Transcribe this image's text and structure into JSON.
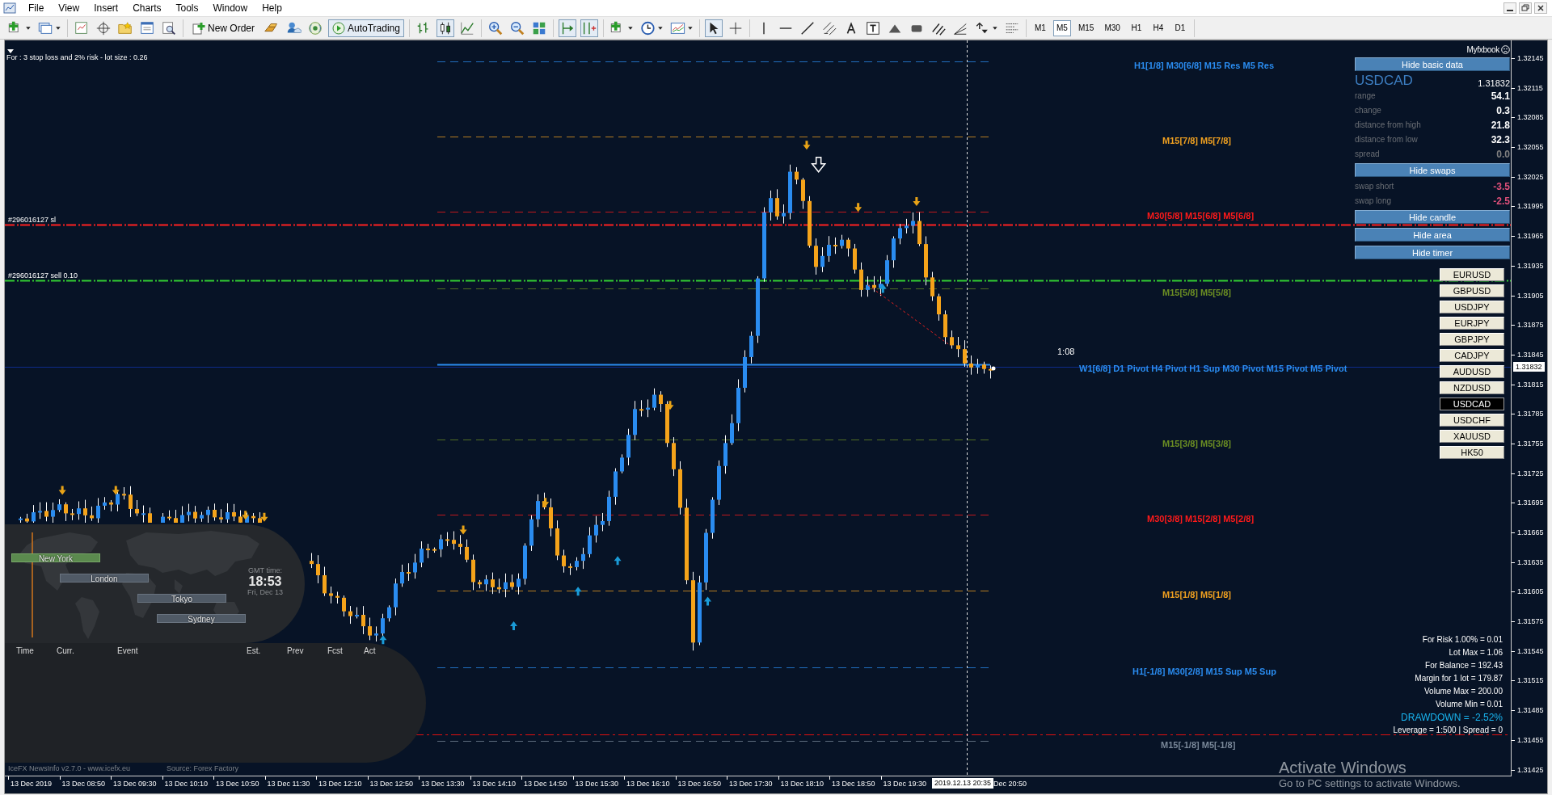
{
  "menu": [
    "File",
    "View",
    "Insert",
    "Charts",
    "Tools",
    "Window",
    "Help"
  ],
  "toolbar": [
    [
      {
        "kind": "icon",
        "pressed": false
      },
      {
        "kind": "icon",
        "pressed": false
      }
    ],
    [
      {
        "kind": "icon",
        "pressed": false
      },
      {
        "kind": "icon",
        "pressed": false
      },
      {
        "kind": "icon",
        "pressed": false
      },
      {
        "kind": "icon",
        "pressed": false
      },
      {
        "kind": "icon",
        "pressed": false
      }
    ],
    [
      {
        "kind": "text",
        "label": "New Order",
        "pressed": false
      },
      {
        "kind": "icon",
        "pressed": false
      },
      {
        "kind": "icon",
        "pressed": false
      },
      {
        "kind": "icon",
        "pressed": false
      },
      {
        "kind": "text",
        "label": "AutoTrading",
        "pressed": true
      }
    ],
    [
      {
        "kind": "icon",
        "pressed": false
      },
      {
        "kind": "icon",
        "pressed": true
      },
      {
        "kind": "icon",
        "pressed": false
      }
    ],
    [
      {
        "kind": "icon",
        "pressed": false
      },
      {
        "kind": "icon",
        "pressed": false
      },
      {
        "kind": "icon",
        "pressed": false
      }
    ],
    [
      {
        "kind": "icon",
        "pressed": true
      },
      {
        "kind": "icon",
        "pressed": true
      }
    ],
    [
      {
        "kind": "icon",
        "pressed": false
      },
      {
        "kind": "icon",
        "pressed": false
      },
      {
        "kind": "icon",
        "pressed": false
      }
    ],
    [
      {
        "kind": "icon",
        "pressed": true
      },
      {
        "kind": "icon",
        "pressed": false
      }
    ],
    [
      {
        "kind": "icon",
        "pressed": false
      },
      {
        "kind": "icon",
        "pressed": false
      },
      {
        "kind": "icon",
        "pressed": false
      },
      {
        "kind": "icon",
        "pressed": false
      },
      {
        "kind": "icon",
        "pressed": false
      },
      {
        "kind": "icon",
        "pressed": false
      },
      {
        "kind": "icon",
        "pressed": false
      },
      {
        "kind": "icon",
        "pressed": false
      },
      {
        "kind": "icon",
        "pressed": false
      },
      {
        "kind": "icon",
        "pressed": false
      },
      {
        "kind": "icon",
        "pressed": false
      },
      {
        "kind": "icon",
        "pressed": false
      }
    ]
  ],
  "periods": [
    {
      "label": "M1",
      "selected": false
    },
    {
      "label": "M5",
      "selected": true
    },
    {
      "label": "M15",
      "selected": false
    },
    {
      "label": "M30",
      "selected": false
    },
    {
      "label": "H1",
      "selected": false
    },
    {
      "label": "H4",
      "selected": false
    },
    {
      "label": "D1",
      "selected": false
    }
  ],
  "chart": {
    "note": "For : 3 stop loss and 2% risk - lot size : 0.26",
    "trade_lines": [
      {
        "label": "#296016127 sl",
        "color": "#ff2020"
      },
      {
        "label": "#296016127 sell 0.10",
        "color": "#32cd32"
      }
    ],
    "levels": [
      {
        "label": "H1[1/8] M30[6/8] M15 Res  M5 Res",
        "color": "#2a8cf0",
        "kind": "dashed"
      },
      {
        "label": "M15[7/8]  M5[7/8]",
        "color": "#f0a020",
        "kind": "dashed"
      },
      {
        "label": "M30[5/8] M15[6/8]  M5[6/8]",
        "color": "#ff1a1a",
        "kind": "dashed"
      },
      {
        "label": "M15[5/8]  M5[5/8]",
        "color": "#6b8e23",
        "kind": "dashed"
      },
      {
        "label": "W1[6/8] D1 Pivot H4 Pivot H1 Sup M30 Pivot M15 Pivot  M5 Pivot",
        "color": "#2a8cf0",
        "kind": "solid"
      },
      {
        "label": "M15[3/8]  M5[3/8]",
        "color": "#6b8e23",
        "kind": "dashed"
      },
      {
        "label": "M30[3/8] M15[2/8]  M5[2/8]",
        "color": "#ff1a1a",
        "kind": "dashed"
      },
      {
        "label": "M15[1/8]  M5[1/8]",
        "color": "#f0a020",
        "kind": "dashed"
      },
      {
        "label": "H1[-1/8] M30[2/8] M15 Sup  M5 Sup",
        "color": "#2a8cf0",
        "kind": "dashed"
      },
      {
        "label": "M15[-1/8]  M5[-1/8]",
        "color": "#7a8899",
        "kind": "dashed"
      }
    ],
    "timer": "1:08",
    "myfxbook": {
      "brand": "Myfxbook",
      "sections": [
        {
          "button": "Hide basic data",
          "symbol": "USDCAD",
          "price": "1.31832",
          "rows": [
            {
              "label": "range",
              "value": "54.1",
              "color": "#ffffff"
            },
            {
              "label": "change",
              "value": "0.3",
              "color": "#ffffff"
            },
            {
              "label": "distance from high",
              "value": "21.8",
              "color": "#ffffff"
            },
            {
              "label": "distance from low",
              "value": "32.3",
              "color": "#ffffff"
            },
            {
              "label": "spread",
              "value": "0.0",
              "color": "#808080"
            }
          ]
        },
        {
          "button": "Hide swaps",
          "rows": [
            {
              "label": "swap short",
              "value": "-3.5",
              "color": "#e0507a"
            },
            {
              "label": "swap long",
              "value": "-2.5",
              "color": "#e0507a"
            }
          ]
        }
      ],
      "buttons": [
        "Hide candle",
        "Hide area",
        "Hide timer"
      ]
    },
    "symbols": [
      {
        "label": "EURUSD",
        "selected": false
      },
      {
        "label": "GBPUSD",
        "selected": false
      },
      {
        "label": "USDJPY",
        "selected": false
      },
      {
        "label": "EURJPY",
        "selected": false
      },
      {
        "label": "GBPJPY",
        "selected": false
      },
      {
        "label": "CADJPY",
        "selected": false
      },
      {
        "label": "AUDUSD",
        "selected": false
      },
      {
        "label": "NZDUSD",
        "selected": false
      },
      {
        "label": "USDCAD",
        "selected": true
      },
      {
        "label": "USDCHF",
        "selected": false
      },
      {
        "label": "XAUUSD",
        "selected": false
      },
      {
        "label": "HK50",
        "selected": false
      }
    ],
    "account_info": [
      "For Risk 1.00% = 0.01",
      "Lot Max = 1.06",
      "For Balance = 192.43",
      "Margin for 1 lot = 179.87",
      "Volume Max = 200.00",
      "Volume Min = 0.01"
    ],
    "drawdown": "DRAWDOWN = -2.52%",
    "leverage": "Leverage = 1:500 | Spread = 0",
    "news": {
      "sessions": [
        {
          "label": "New York",
          "active": true
        },
        {
          "label": "London",
          "active": false
        },
        {
          "label": "Tokyo",
          "active": false
        },
        {
          "label": "Sydney",
          "active": false
        }
      ],
      "gmt_label": "GMT time:",
      "time": "18:53",
      "date": "Fri, Dec 13",
      "columns": [
        "Time",
        "Curr.",
        "Event",
        "Est.",
        "Prev",
        "Fcst",
        "Act"
      ],
      "footer": "IceFX NewsInfo v2.7.0  -  www.icefx.eu",
      "source": "Source: Forex Factory"
    }
  },
  "price_axis": {
    "ticks": [
      "1.32145",
      "1.32115",
      "1.32085",
      "1.32055",
      "1.32025",
      "1.31995",
      "1.31965",
      "1.31935",
      "1.31905",
      "1.31875",
      "1.31845",
      "1.31815",
      "1.31785",
      "1.31755",
      "1.31725",
      "1.31695",
      "1.31665",
      "1.31635",
      "1.31605",
      "1.31575",
      "1.31545",
      "1.31515",
      "1.31485",
      "1.31455",
      "1.31425"
    ],
    "current": "1.31832"
  },
  "time_axis": {
    "ticks": [
      "13 Dec 2019",
      "13 Dec 08:50",
      "13 Dec 09:30",
      "13 Dec 10:10",
      "13 Dec 10:50",
      "13 Dec 11:30",
      "13 Dec 12:10",
      "13 Dec 12:50",
      "13 Dec 13:30",
      "13 Dec 14:10",
      "13 Dec 14:50",
      "13 Dec 15:30",
      "13 Dec 16:10",
      "13 Dec 16:50",
      "13 Dec 17:30",
      "13 Dec 18:10",
      "13 Dec 18:50",
      "13 Dec 19:30"
    ],
    "cursor": "2019.12.13 20:35",
    "after": "Dec 20:50"
  },
  "os_notice": [
    "Activate Windows",
    "Go to PC settings to activate Windows."
  ]
}
